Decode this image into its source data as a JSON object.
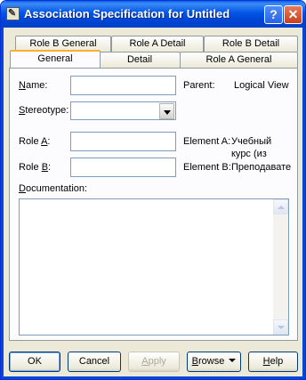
{
  "window": {
    "title": "Association Specification for Untitled",
    "help_glyph": "?",
    "close_glyph": "✕",
    "icon_glyph": "✎"
  },
  "tabs_back": [
    "Role B General",
    "Role A Detail",
    "Role B Detail"
  ],
  "tabs_front": [
    "General",
    "Detail",
    "Role A General"
  ],
  "active_tab": "General",
  "form": {
    "name_label": "Name:",
    "name_value": "",
    "parent_label": "Parent:",
    "parent_value": "Logical View",
    "stereotype_label": "Stereotype:",
    "stereotype_value": "",
    "role_a_label": "Role A:",
    "role_a_value": "",
    "element_a_label": "Element A:",
    "element_a_value_line1": "Учебный",
    "element_a_value_line2": "курс (из",
    "role_b_label": "Role B:",
    "role_b_value": "",
    "element_b_label": "Element B:",
    "element_b_value": "Преподавате",
    "documentation_label": "Documentation:",
    "documentation_value": ""
  },
  "buttons": {
    "ok": "OK",
    "cancel": "Cancel",
    "apply": "Apply",
    "browse": "Browse",
    "help": "Help"
  },
  "colors": {
    "title_bar": "#0055e5",
    "window_bg": "#ece9d8",
    "tab_highlight": "#f9b030",
    "close_button": "#c8401c"
  }
}
